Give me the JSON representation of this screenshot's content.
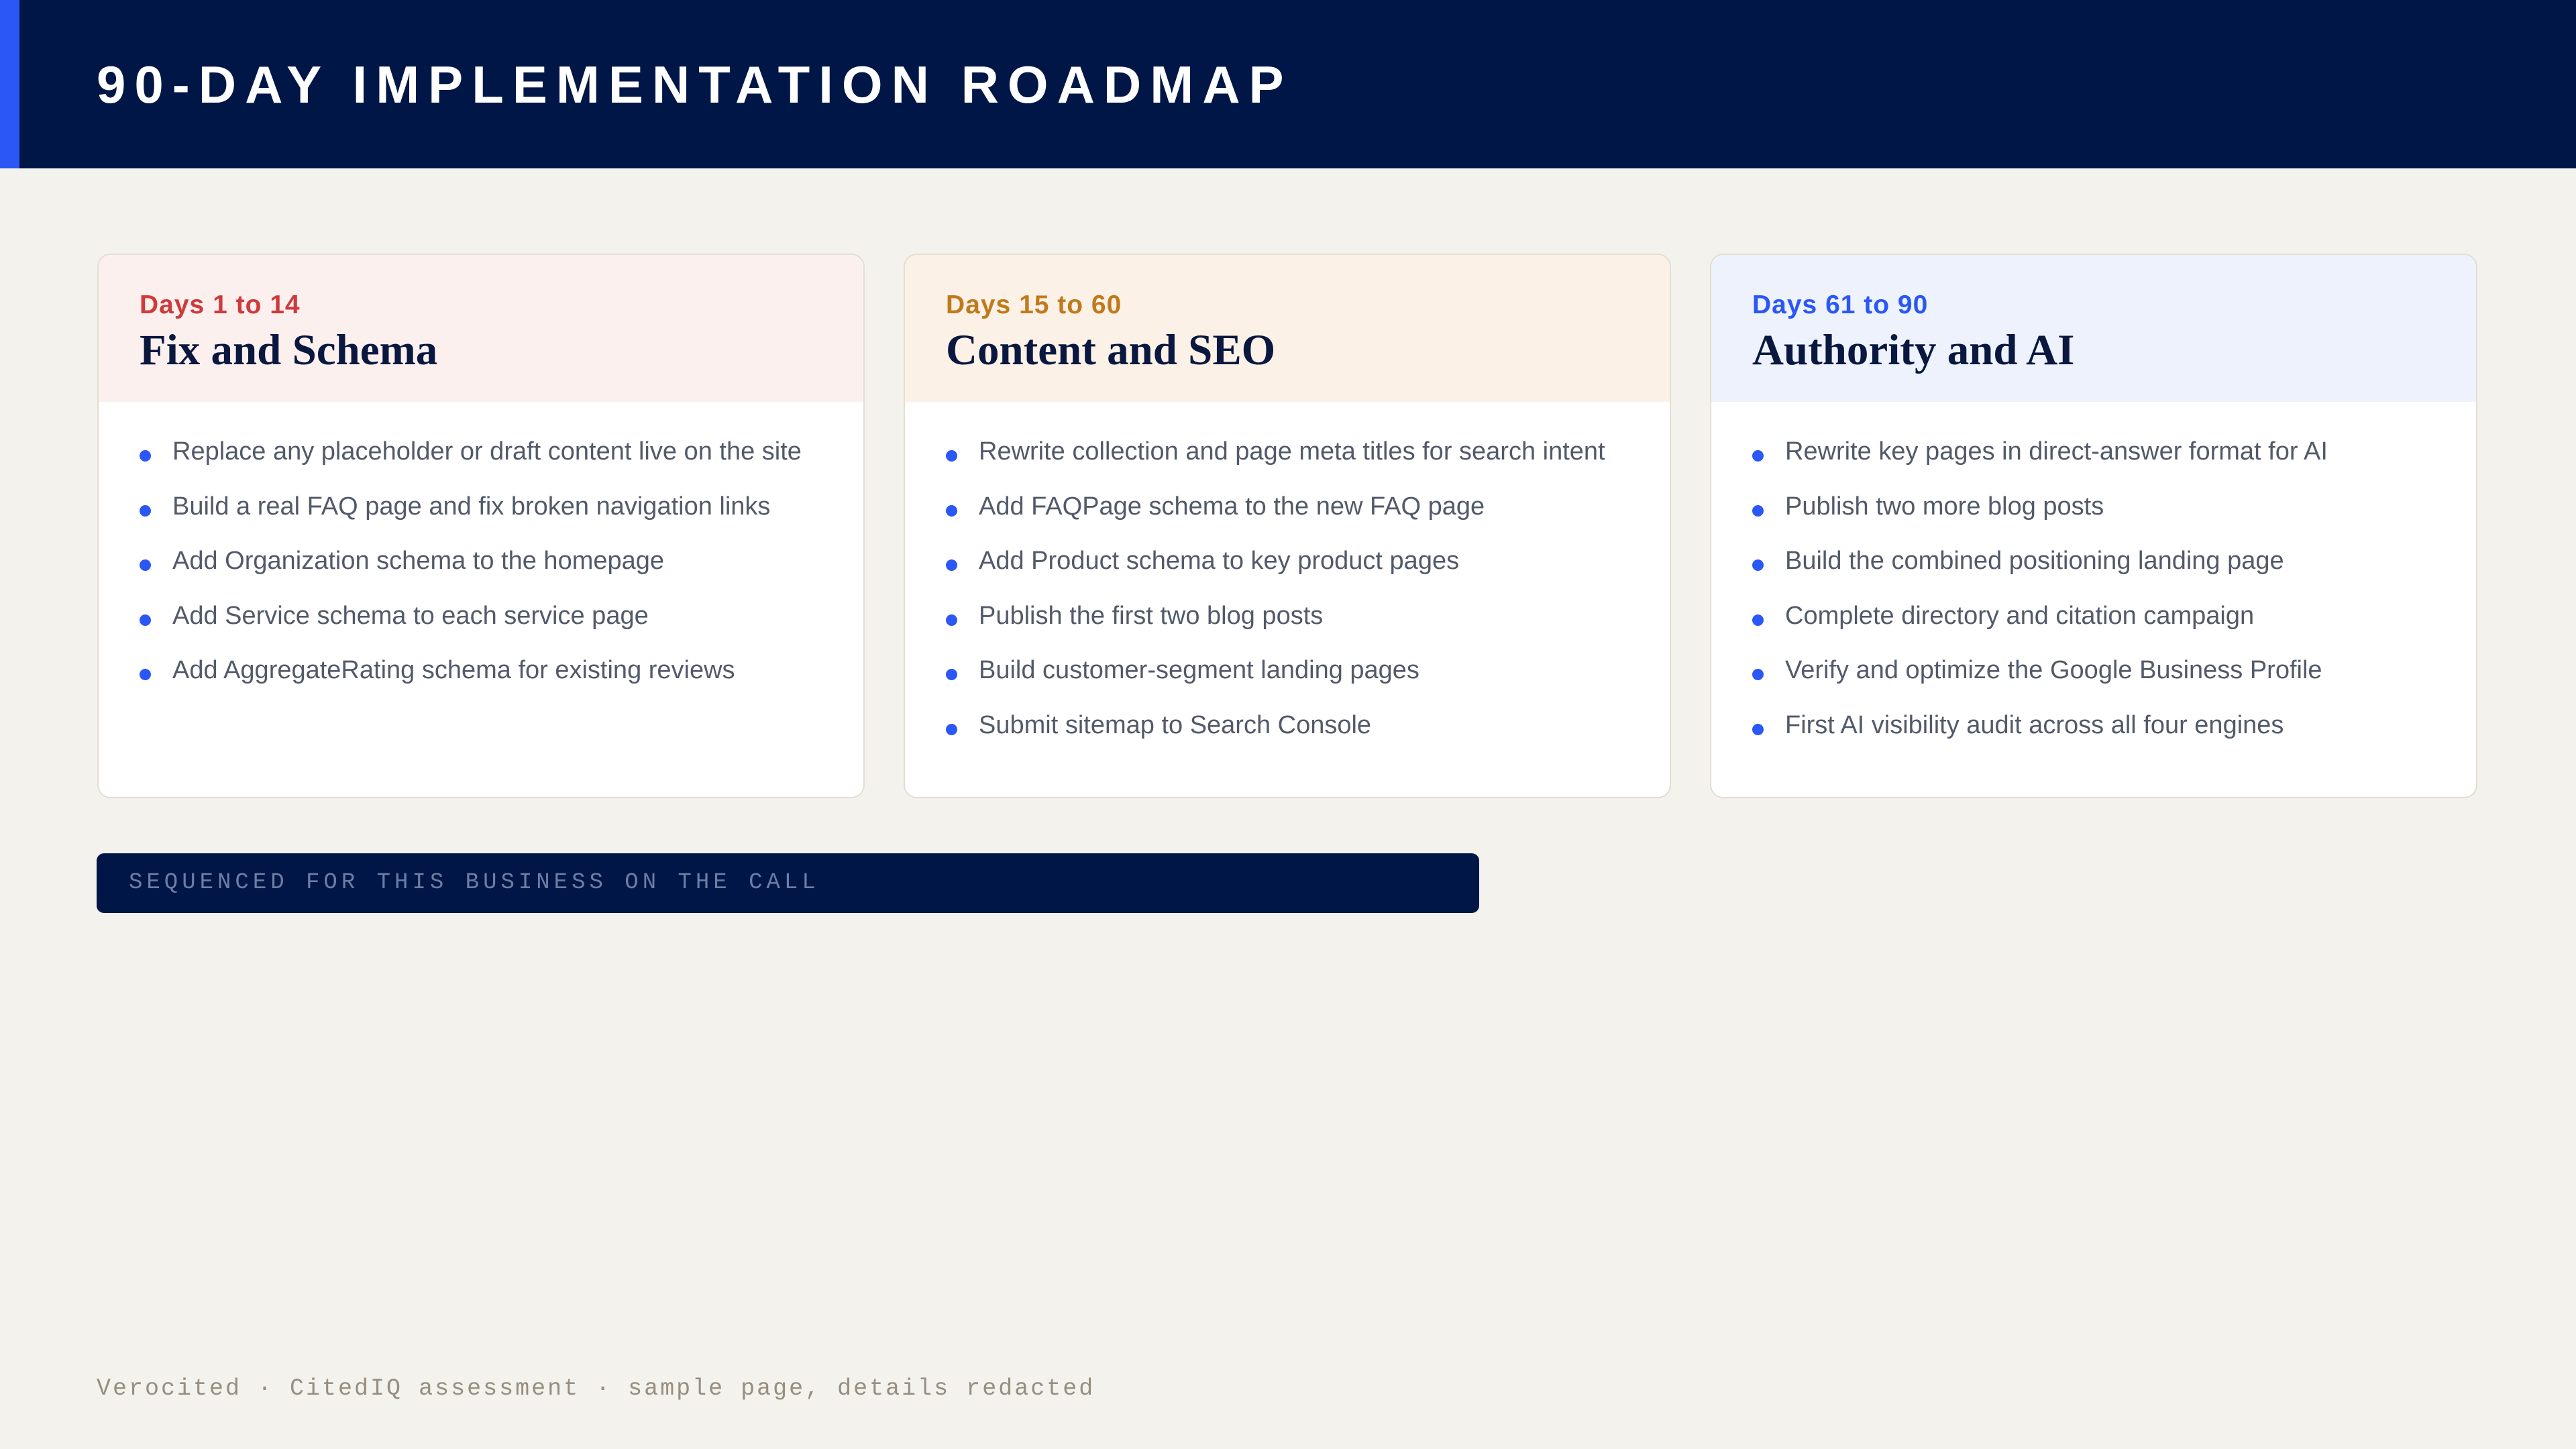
{
  "header": {
    "title": "90-DAY IMPLEMENTATION ROADMAP",
    "background_color": "#001646",
    "accent_color": "#2a57f5"
  },
  "phases": [
    {
      "range": "Days 1 to 14",
      "title": "Fix and Schema",
      "accent_color": "#cf3a3a",
      "header_bg": "#fcf0ef",
      "items": [
        "Replace any placeholder or draft content live on the site",
        "Build a real FAQ page and fix broken navigation links",
        "Add Organization schema to the homepage",
        "Add Service schema to each service page",
        "Add AggregateRating schema for existing reviews"
      ]
    },
    {
      "range": "Days 15 to 60",
      "title": "Content and SEO",
      "accent_color": "#c07a1c",
      "header_bg": "#fbf1e7",
      "items": [
        "Rewrite collection and page meta titles for search intent",
        "Add FAQPage schema to the new FAQ page",
        "Add Product schema to key product pages",
        "Publish the first two blog posts",
        "Build customer-segment landing pages",
        "Submit sitemap to Search Console"
      ]
    },
    {
      "range": "Days 61 to 90",
      "title": "Authority and AI",
      "accent_color": "#2a57f5",
      "header_bg": "#edf2fd",
      "items": [
        "Rewrite key pages in direct-answer format for AI",
        "Publish two more blog posts",
        "Build the combined positioning landing page",
        "Complete directory and citation campaign",
        "Verify and optimize the Google Business Profile",
        "First AI visibility audit across all four engines"
      ]
    }
  ],
  "bullet_color": "#2a57f5",
  "banner": {
    "text": "SEQUENCED FOR THIS BUSINESS ON THE CALL"
  },
  "footer": {
    "text": "Verocited · CitedIQ assessment · sample page, details redacted"
  }
}
